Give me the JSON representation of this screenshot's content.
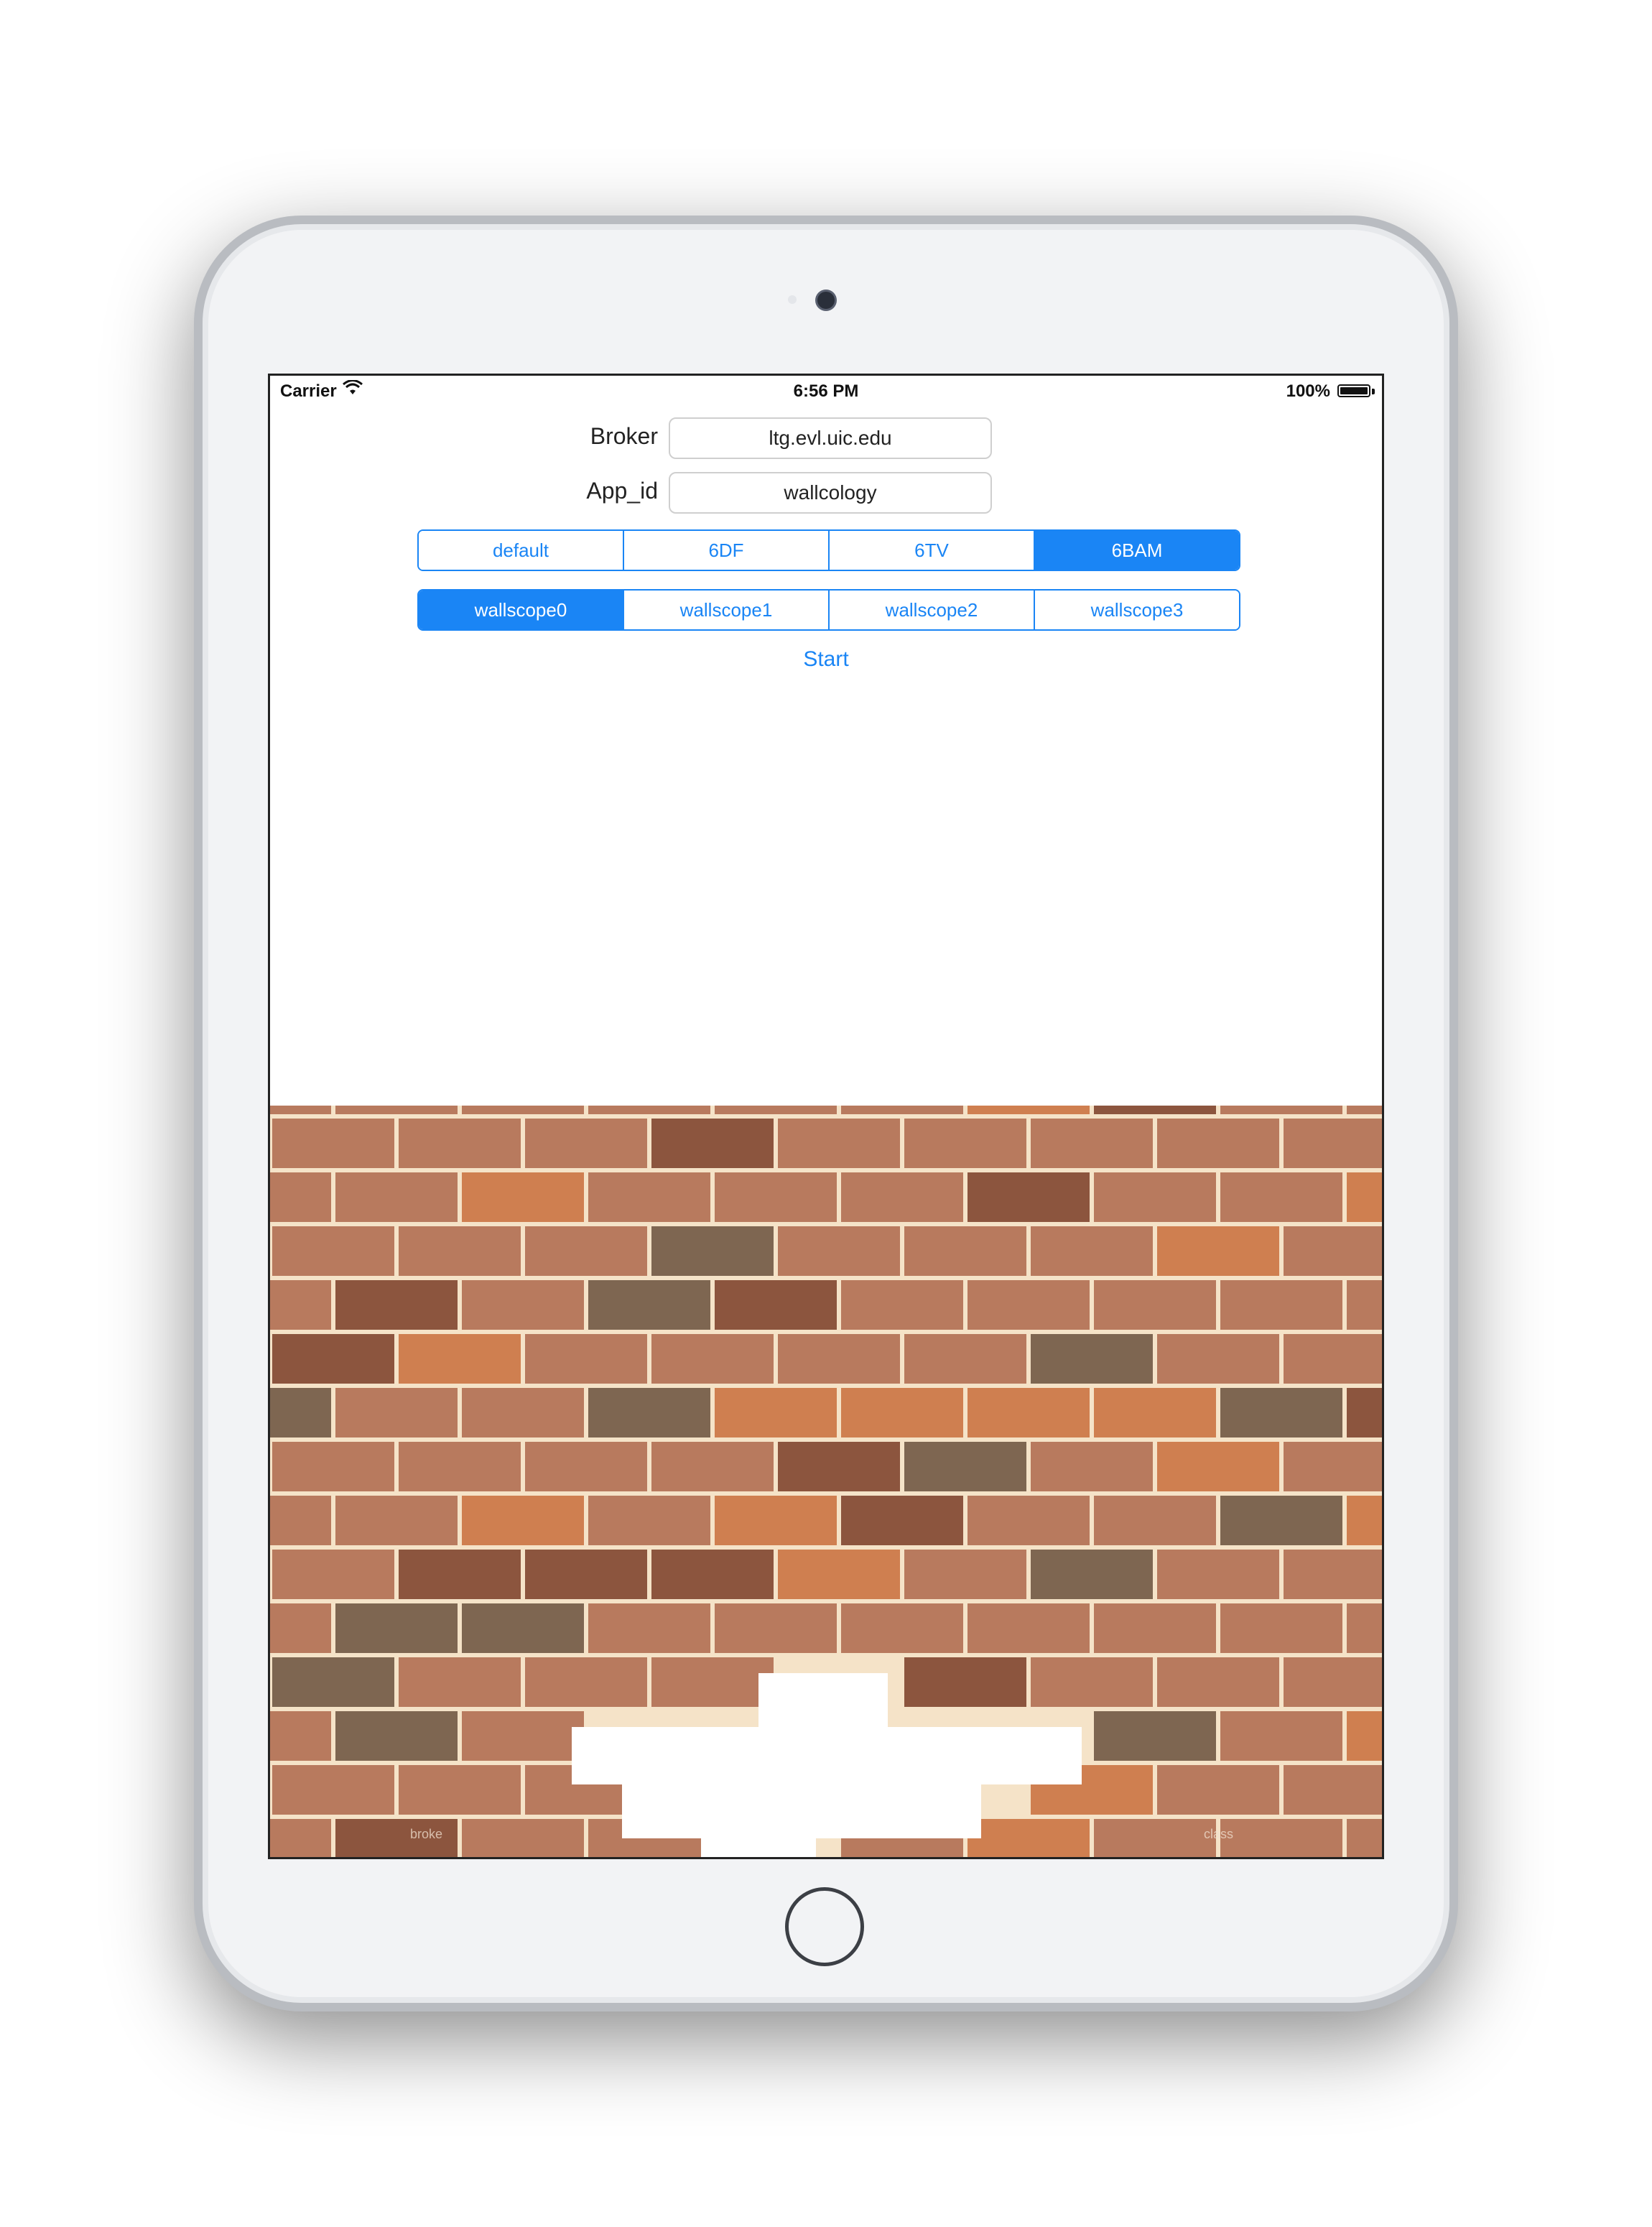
{
  "statusbar": {
    "carrier": "Carrier",
    "time": "6:56 PM",
    "battery": "100%"
  },
  "form": {
    "broker_label": "Broker",
    "broker_value": "ltg.evl.uic.edu",
    "appid_label": "App_id",
    "appid_value": "wallcology"
  },
  "class_selector": {
    "options": [
      "default",
      "6DF",
      "6TV",
      "6BAM"
    ],
    "selected_index": 3
  },
  "wallscope_selector": {
    "options": [
      "wallscope0",
      "wallscope1",
      "wallscope2",
      "wallscope3"
    ],
    "selected_index": 0
  },
  "start_label": "Start",
  "wall": {
    "caption_left": "broke",
    "caption_right": "class"
  },
  "colors": {
    "accent": "#1a85f5",
    "mortar": "#f5e3c8",
    "brick_main": "#b87a5e",
    "brick_dark": "#8c553e",
    "brick_gray": "#7e6651",
    "brick_orange": "#cf7f50"
  }
}
